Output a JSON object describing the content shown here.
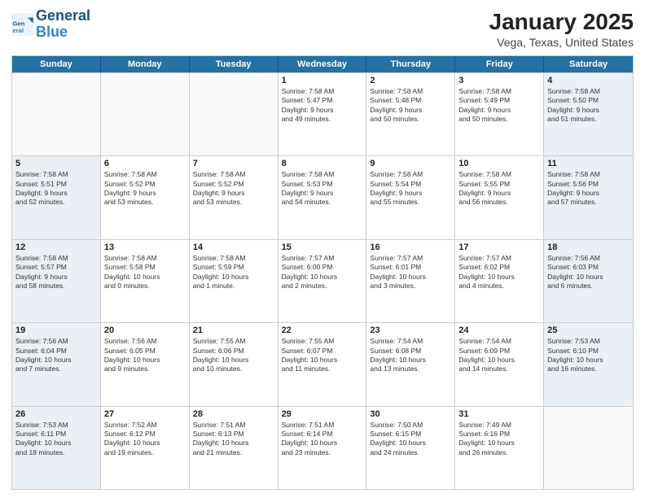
{
  "logo": {
    "line1": "General",
    "line2": "Blue"
  },
  "title": "January 2025",
  "subtitle": "Vega, Texas, United States",
  "days_of_week": [
    "Sunday",
    "Monday",
    "Tuesday",
    "Wednesday",
    "Thursday",
    "Friday",
    "Saturday"
  ],
  "weeks": [
    [
      {
        "day": "",
        "info": "",
        "empty": true
      },
      {
        "day": "",
        "info": "",
        "empty": true
      },
      {
        "day": "",
        "info": "",
        "empty": true
      },
      {
        "day": "1",
        "info": "Sunrise: 7:58 AM\nSunset: 5:47 PM\nDaylight: 9 hours\nand 49 minutes."
      },
      {
        "day": "2",
        "info": "Sunrise: 7:58 AM\nSunset: 5:48 PM\nDaylight: 9 hours\nand 50 minutes."
      },
      {
        "day": "3",
        "info": "Sunrise: 7:58 AM\nSunset: 5:49 PM\nDaylight: 9 hours\nand 50 minutes."
      },
      {
        "day": "4",
        "info": "Sunrise: 7:58 AM\nSunset: 5:50 PM\nDaylight: 9 hours\nand 51 minutes."
      }
    ],
    [
      {
        "day": "5",
        "info": "Sunrise: 7:58 AM\nSunset: 5:51 PM\nDaylight: 9 hours\nand 52 minutes."
      },
      {
        "day": "6",
        "info": "Sunrise: 7:58 AM\nSunset: 5:52 PM\nDaylight: 9 hours\nand 53 minutes."
      },
      {
        "day": "7",
        "info": "Sunrise: 7:58 AM\nSunset: 5:52 PM\nDaylight: 9 hours\nand 53 minutes."
      },
      {
        "day": "8",
        "info": "Sunrise: 7:58 AM\nSunset: 5:53 PM\nDaylight: 9 hours\nand 54 minutes."
      },
      {
        "day": "9",
        "info": "Sunrise: 7:58 AM\nSunset: 5:54 PM\nDaylight: 9 hours\nand 55 minutes."
      },
      {
        "day": "10",
        "info": "Sunrise: 7:58 AM\nSunset: 5:55 PM\nDaylight: 9 hours\nand 56 minutes."
      },
      {
        "day": "11",
        "info": "Sunrise: 7:58 AM\nSunset: 5:56 PM\nDaylight: 9 hours\nand 57 minutes."
      }
    ],
    [
      {
        "day": "12",
        "info": "Sunrise: 7:58 AM\nSunset: 5:57 PM\nDaylight: 9 hours\nand 58 minutes."
      },
      {
        "day": "13",
        "info": "Sunrise: 7:58 AM\nSunset: 5:58 PM\nDaylight: 10 hours\nand 0 minutes."
      },
      {
        "day": "14",
        "info": "Sunrise: 7:58 AM\nSunset: 5:59 PM\nDaylight: 10 hours\nand 1 minute."
      },
      {
        "day": "15",
        "info": "Sunrise: 7:57 AM\nSunset: 6:00 PM\nDaylight: 10 hours\nand 2 minutes."
      },
      {
        "day": "16",
        "info": "Sunrise: 7:57 AM\nSunset: 6:01 PM\nDaylight: 10 hours\nand 3 minutes."
      },
      {
        "day": "17",
        "info": "Sunrise: 7:57 AM\nSunset: 6:02 PM\nDaylight: 10 hours\nand 4 minutes."
      },
      {
        "day": "18",
        "info": "Sunrise: 7:56 AM\nSunset: 6:03 PM\nDaylight: 10 hours\nand 6 minutes."
      }
    ],
    [
      {
        "day": "19",
        "info": "Sunrise: 7:56 AM\nSunset: 6:04 PM\nDaylight: 10 hours\nand 7 minutes."
      },
      {
        "day": "20",
        "info": "Sunrise: 7:56 AM\nSunset: 6:05 PM\nDaylight: 10 hours\nand 9 minutes."
      },
      {
        "day": "21",
        "info": "Sunrise: 7:55 AM\nSunset: 6:06 PM\nDaylight: 10 hours\nand 10 minutes."
      },
      {
        "day": "22",
        "info": "Sunrise: 7:55 AM\nSunset: 6:07 PM\nDaylight: 10 hours\nand 11 minutes."
      },
      {
        "day": "23",
        "info": "Sunrise: 7:54 AM\nSunset: 6:08 PM\nDaylight: 10 hours\nand 13 minutes."
      },
      {
        "day": "24",
        "info": "Sunrise: 7:54 AM\nSunset: 6:09 PM\nDaylight: 10 hours\nand 14 minutes."
      },
      {
        "day": "25",
        "info": "Sunrise: 7:53 AM\nSunset: 6:10 PM\nDaylight: 10 hours\nand 16 minutes."
      }
    ],
    [
      {
        "day": "26",
        "info": "Sunrise: 7:53 AM\nSunset: 6:11 PM\nDaylight: 10 hours\nand 18 minutes."
      },
      {
        "day": "27",
        "info": "Sunrise: 7:52 AM\nSunset: 6:12 PM\nDaylight: 10 hours\nand 19 minutes."
      },
      {
        "day": "28",
        "info": "Sunrise: 7:51 AM\nSunset: 6:13 PM\nDaylight: 10 hours\nand 21 minutes."
      },
      {
        "day": "29",
        "info": "Sunrise: 7:51 AM\nSunset: 6:14 PM\nDaylight: 10 hours\nand 23 minutes."
      },
      {
        "day": "30",
        "info": "Sunrise: 7:50 AM\nSunset: 6:15 PM\nDaylight: 10 hours\nand 24 minutes."
      },
      {
        "day": "31",
        "info": "Sunrise: 7:49 AM\nSunset: 6:16 PM\nDaylight: 10 hours\nand 26 minutes."
      },
      {
        "day": "",
        "info": "",
        "empty": true
      }
    ]
  ]
}
